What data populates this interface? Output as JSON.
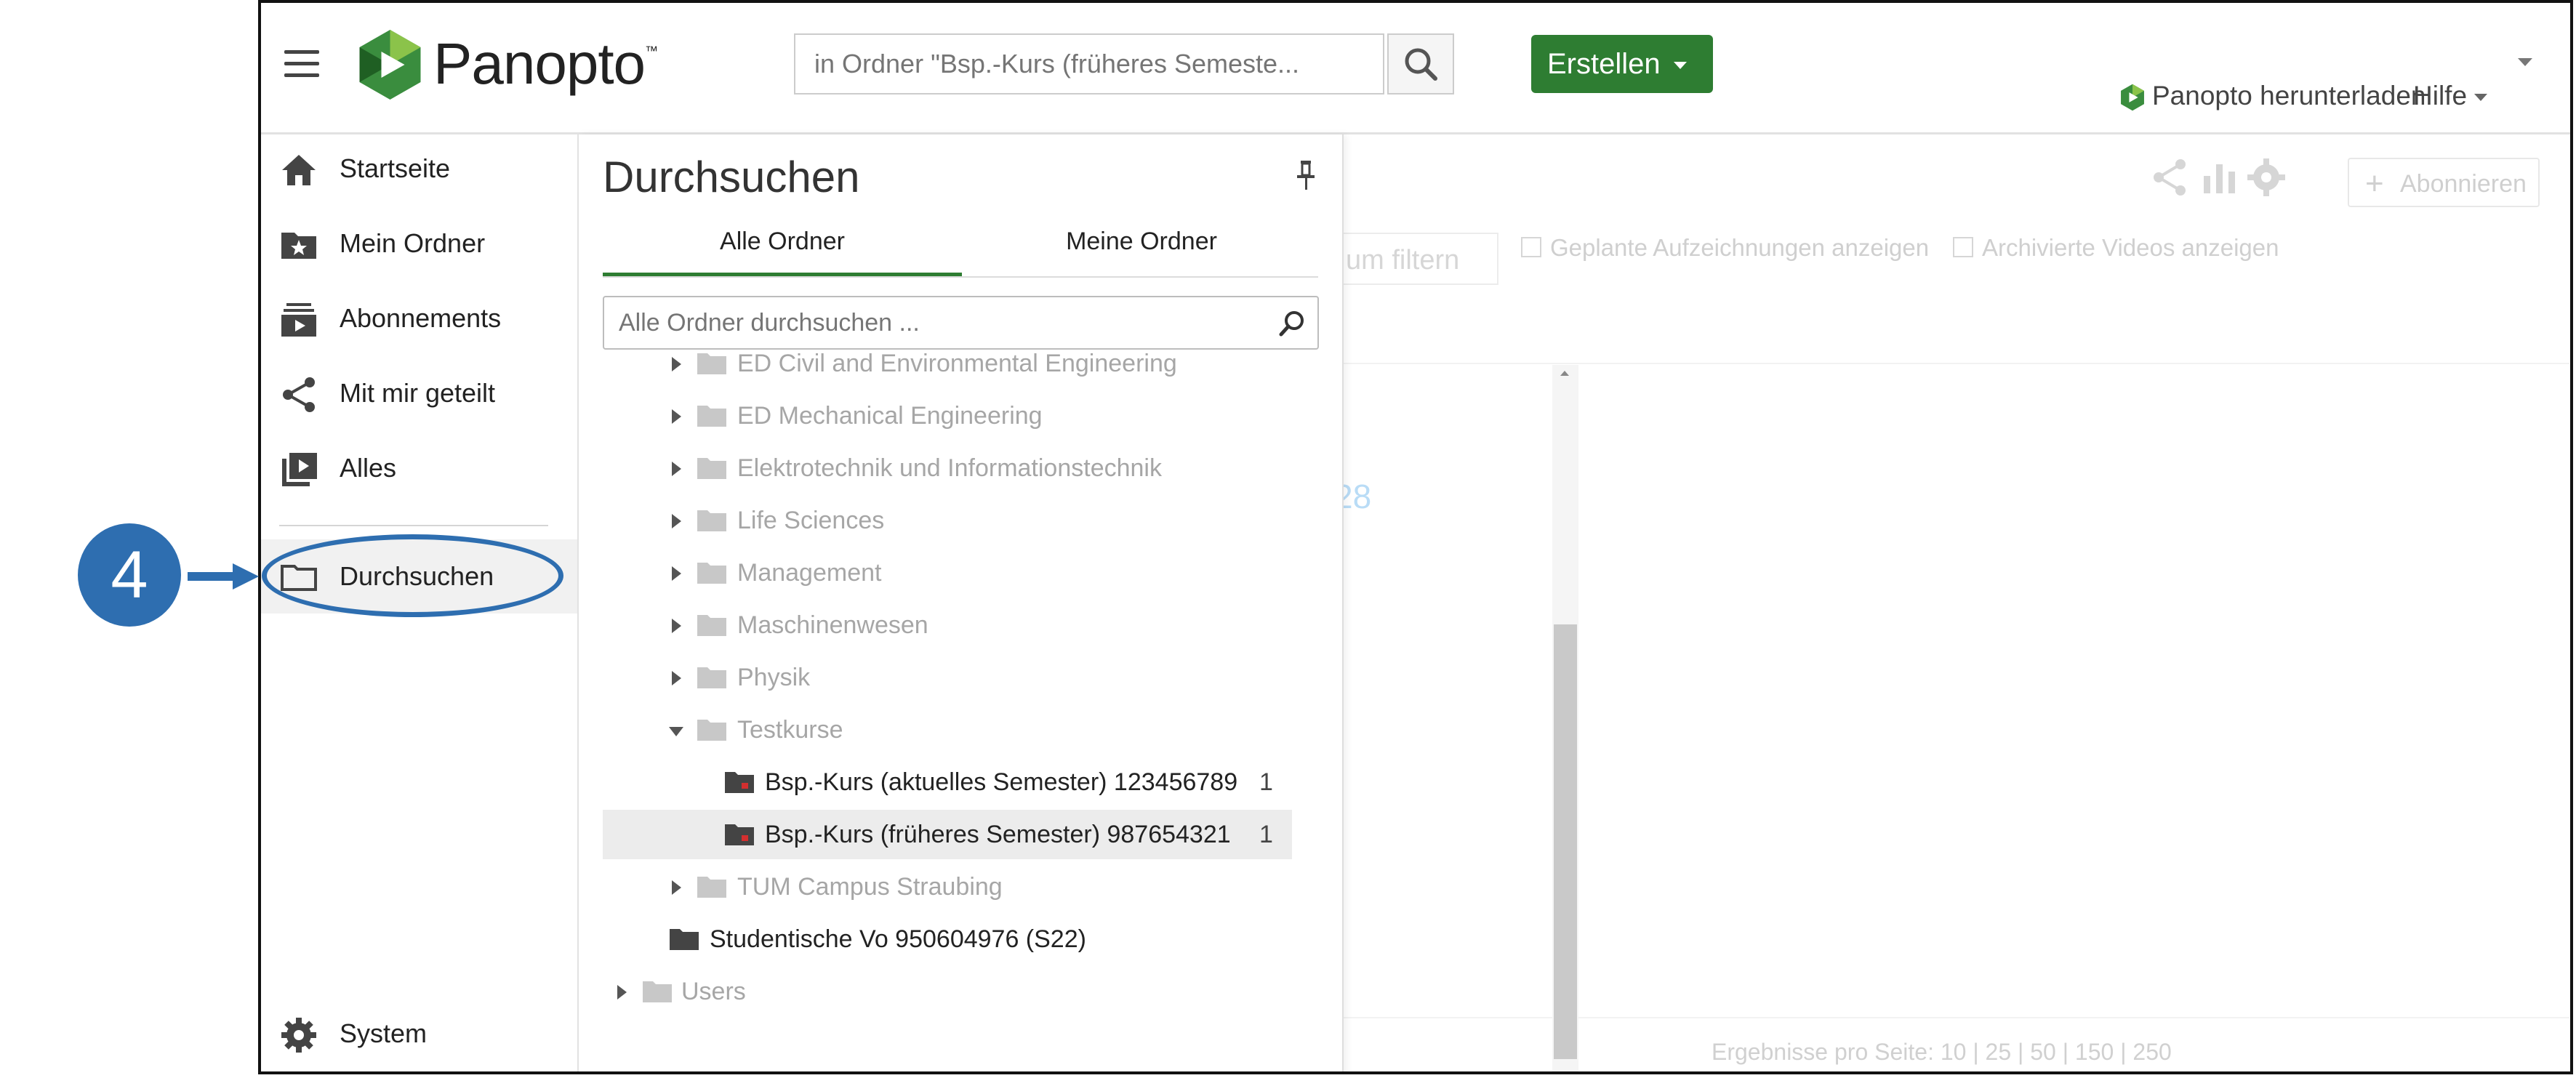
{
  "header": {
    "brand": "Panopto",
    "trademark": "™",
    "search_placeholder": "in Ordner \"Bsp.-Kurs (früheres Semeste...",
    "create_label": "Erstellen",
    "download_label": "Panopto herunterladen",
    "help_label": "Hilfe"
  },
  "nav": {
    "items": [
      {
        "label": "Startseite",
        "icon": "home-icon"
      },
      {
        "label": "Mein Ordner",
        "icon": "folder-star-icon"
      },
      {
        "label": "Abonnements",
        "icon": "subscriptions-icon"
      },
      {
        "label": "Mit mir geteilt",
        "icon": "share-icon"
      },
      {
        "label": "Alles",
        "icon": "video-library-icon"
      },
      {
        "label": "Durchsuchen",
        "icon": "folder-icon"
      }
    ],
    "system_label": "System",
    "active": "Durchsuchen"
  },
  "browse": {
    "title": "Durchsuchen",
    "tabs": [
      "Alle Ordner",
      "Meine Ordner"
    ],
    "active_tab": "Alle Ordner",
    "search_placeholder": "Alle Ordner durchsuchen ...",
    "tree": [
      {
        "label": "ED Civil and Environmental Engineering",
        "state": "collapsed"
      },
      {
        "label": "ED Mechanical Engineering",
        "state": "collapsed"
      },
      {
        "label": "Elektrotechnik und Informationstechnik",
        "state": "collapsed"
      },
      {
        "label": "Life Sciences",
        "state": "collapsed"
      },
      {
        "label": "Management",
        "state": "collapsed"
      },
      {
        "label": "Maschinenwesen",
        "state": "collapsed"
      },
      {
        "label": "Physik",
        "state": "collapsed"
      },
      {
        "label": "Testkurse",
        "state": "expanded"
      },
      {
        "label": "Bsp.-Kurs (aktuelles Semester) 123456789",
        "count": "1"
      },
      {
        "label": "Bsp.-Kurs (früheres Semester) 987654321",
        "count": "1",
        "selected": true
      },
      {
        "label": "TUM Campus Straubing",
        "state": "collapsed"
      },
      {
        "label": "Studentische Vo 950604976 (S22)"
      },
      {
        "label": "Users",
        "state": "collapsed"
      }
    ]
  },
  "background": {
    "subscribe_label": "Abonnieren",
    "filter_label": "um filtern",
    "check_planned": "Geplante Aufzeichnungen anzeigen",
    "check_archived": "Archivierte Videos anzeigen",
    "partial_number": "28",
    "pager": "Ergebnisse pro Seite:  10  |  25  |  50  |  150  |  250"
  },
  "annotation": {
    "step_number": "4",
    "color": "#2e6eb0"
  },
  "colors": {
    "accent_green": "#2e7d32",
    "annotation_blue": "#2e6eb0"
  }
}
